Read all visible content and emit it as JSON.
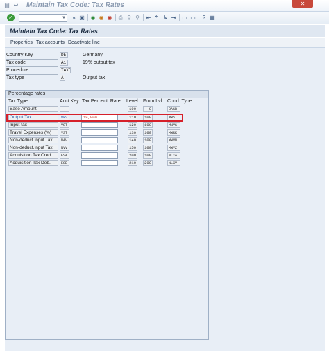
{
  "window": {
    "title": "Maintain Tax Code: Tax Rates",
    "close_label": "✕"
  },
  "toolbar": {
    "command_value": ""
  },
  "screen": {
    "title": "Maintain Tax Code: Tax Rates"
  },
  "app_toolbar": {
    "properties": "Properties",
    "tax_accounts": "Tax accounts",
    "deactivate_line": "Deactivate line"
  },
  "header": {
    "country_key": {
      "label": "Country Key",
      "value": "DE",
      "text": "Germany"
    },
    "tax_code": {
      "label": "Tax code",
      "value": "A1",
      "text": "19% output tax"
    },
    "procedure": {
      "label": "Procedure",
      "value": "TAXD"
    },
    "tax_type": {
      "label": "Tax type",
      "value": "A",
      "text": "Output tax"
    }
  },
  "rates": {
    "group_title": "Percentage rates",
    "columns": {
      "tax_type": "Tax Type",
      "acct_key": "Acct Key",
      "rate": "Tax Percent. Rate",
      "level": "Level",
      "from_lvl": "From Lvl",
      "cond_type": "Cond. Type"
    },
    "rows": [
      {
        "tax_type": "Base Amount",
        "acct_key": "",
        "rate": "",
        "level": "100",
        "from_lvl": "0",
        "cond_type": "BASB"
      },
      {
        "tax_type": "Output Tax",
        "acct_key": "MWS",
        "rate": "19,000",
        "level": "110",
        "from_lvl": "100",
        "cond_type": "MWST"
      },
      {
        "tax_type": "Input tax",
        "acct_key": "VST",
        "rate": "",
        "level": "120",
        "from_lvl": "100",
        "cond_type": "MWVS"
      },
      {
        "tax_type": "Travel Expenses (%)",
        "acct_key": "VST",
        "rate": "",
        "level": "130",
        "from_lvl": "100",
        "cond_type": "MWRK"
      },
      {
        "tax_type": "Non-deduct.Input Tax",
        "acct_key": "NAV",
        "rate": "",
        "level": "140",
        "from_lvl": "100",
        "cond_type": "MWVN"
      },
      {
        "tax_type": "Non-deduct.Input Tax",
        "acct_key": "NVV",
        "rate": "",
        "level": "150",
        "from_lvl": "100",
        "cond_type": "MWVZ"
      },
      {
        "tax_type": "Acquisition Tax Cred",
        "acct_key": "ESA",
        "rate": "",
        "level": "200",
        "from_lvl": "100",
        "cond_type": "NLXA"
      },
      {
        "tax_type": "Acquisition Tax Deb.",
        "acct_key": "ESE",
        "rate": "",
        "level": "210",
        "from_lvl": "200",
        "cond_type": "NLXV"
      }
    ]
  }
}
